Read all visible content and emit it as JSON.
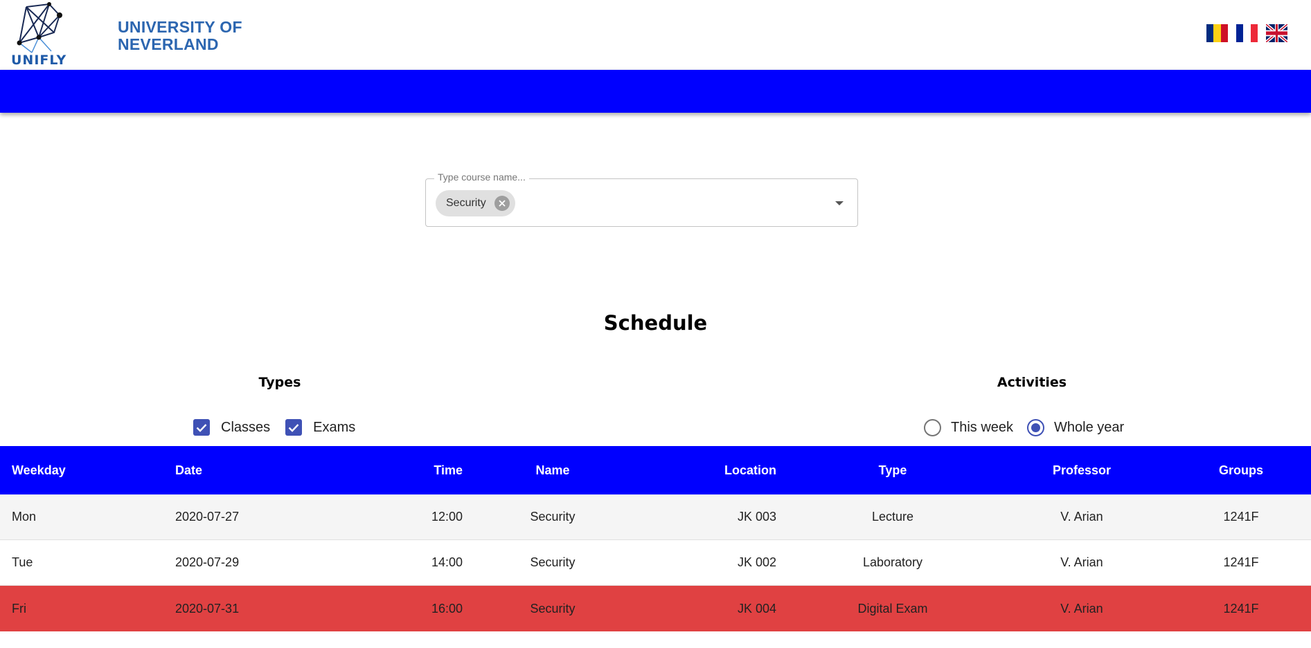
{
  "header": {
    "logo_text": "UNIFLY",
    "university_line1": "UNIVERSITY OF",
    "university_line2": "NEVERLAND",
    "languages": [
      {
        "code": "ro",
        "colors": [
          "#002b7f",
          "#fcd116",
          "#ce1126"
        ]
      },
      {
        "code": "fr",
        "colors": [
          "#002395",
          "#ffffff",
          "#ed2939"
        ]
      },
      {
        "code": "en",
        "colors": [
          "#012169",
          "#ffffff",
          "#c8102e"
        ]
      }
    ]
  },
  "course_search": {
    "label": "Type course name...",
    "selected_chip": "Security",
    "chip_delete_icon": "cancel-circle-icon",
    "dropdown_icon": "arrow-drop-down-icon"
  },
  "schedule": {
    "title": "Schedule",
    "types_title": "Types",
    "activities_title": "Activities",
    "types": [
      {
        "label": "Classes",
        "checked": true
      },
      {
        "label": "Exams",
        "checked": true
      }
    ],
    "activities": [
      {
        "label": "This week",
        "selected": false
      },
      {
        "label": "Whole year",
        "selected": true
      }
    ]
  },
  "table": {
    "columns": [
      "Weekday",
      "Date",
      "Time",
      "Name",
      "Location",
      "Type",
      "Professor",
      "Groups"
    ],
    "rows": [
      [
        "Mon",
        "2020-07-27",
        "12:00",
        "Security",
        "JK 003",
        "Lecture",
        "V. Arian",
        "1241F"
      ],
      [
        "Tue",
        "2020-07-29",
        "14:00",
        "Security",
        "JK 002",
        "Laboratory",
        "V. Arian",
        "1241F"
      ],
      [
        "Fri",
        "2020-07-31",
        "16:00",
        "Security",
        "JK 004",
        "Digital Exam",
        "V. Arian",
        "1241F"
      ]
    ]
  },
  "colors": {
    "primary_bar": "#0000ff",
    "accent": "#3f51b5",
    "exam_row": "#e04142",
    "brand_text": "#2c66b0"
  }
}
